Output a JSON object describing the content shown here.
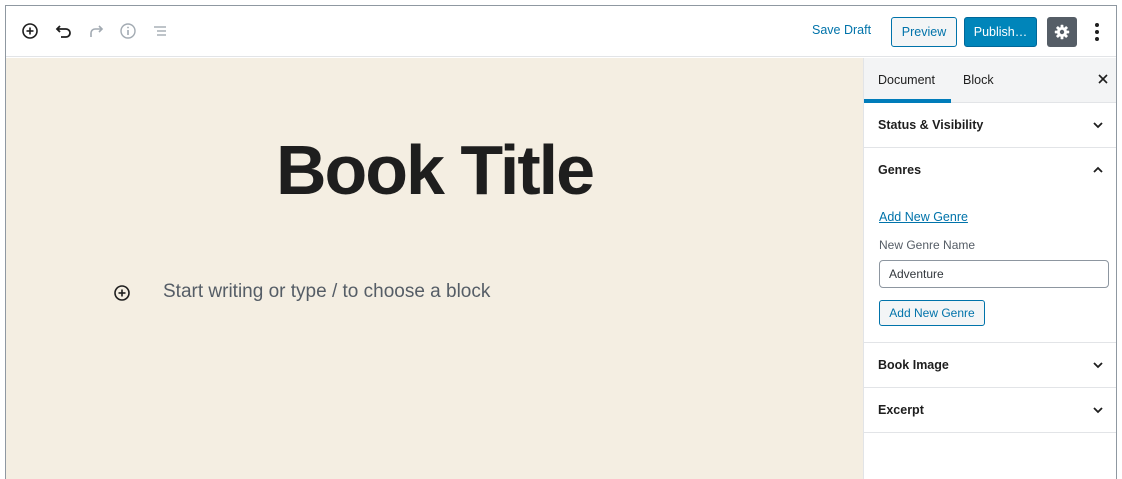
{
  "toolbar": {
    "icons": [
      "add-block-icon",
      "undo-icon",
      "redo-icon",
      "info-icon",
      "outline-icon",
      "gear-icon",
      "more-vertical-icon"
    ],
    "save_draft_label": "Save Draft",
    "preview_label": "Preview",
    "publish_label": "Publish…"
  },
  "editor": {
    "title": "Book Title",
    "placeholder": "Start writing or type / to choose a block",
    "background_color": "#f4eee2"
  },
  "sidebar": {
    "tabs": [
      {
        "label": "Document",
        "active": true
      },
      {
        "label": "Block",
        "active": false
      }
    ],
    "close_icon": "close-icon",
    "panels": [
      {
        "title": "Status & Visibility",
        "expanded": false
      },
      {
        "title": "Genres",
        "expanded": true,
        "add_new_link": "Add New Genre",
        "field_label": "New Genre Name",
        "field_value": "Adventure",
        "add_button_label": "Add New Genre"
      },
      {
        "title": "Book Image",
        "expanded": false
      },
      {
        "title": "Excerpt",
        "expanded": false
      }
    ]
  },
  "colors": {
    "accent": "#0085ba",
    "link": "#0073aa",
    "settings_button_bg": "#555d66"
  }
}
